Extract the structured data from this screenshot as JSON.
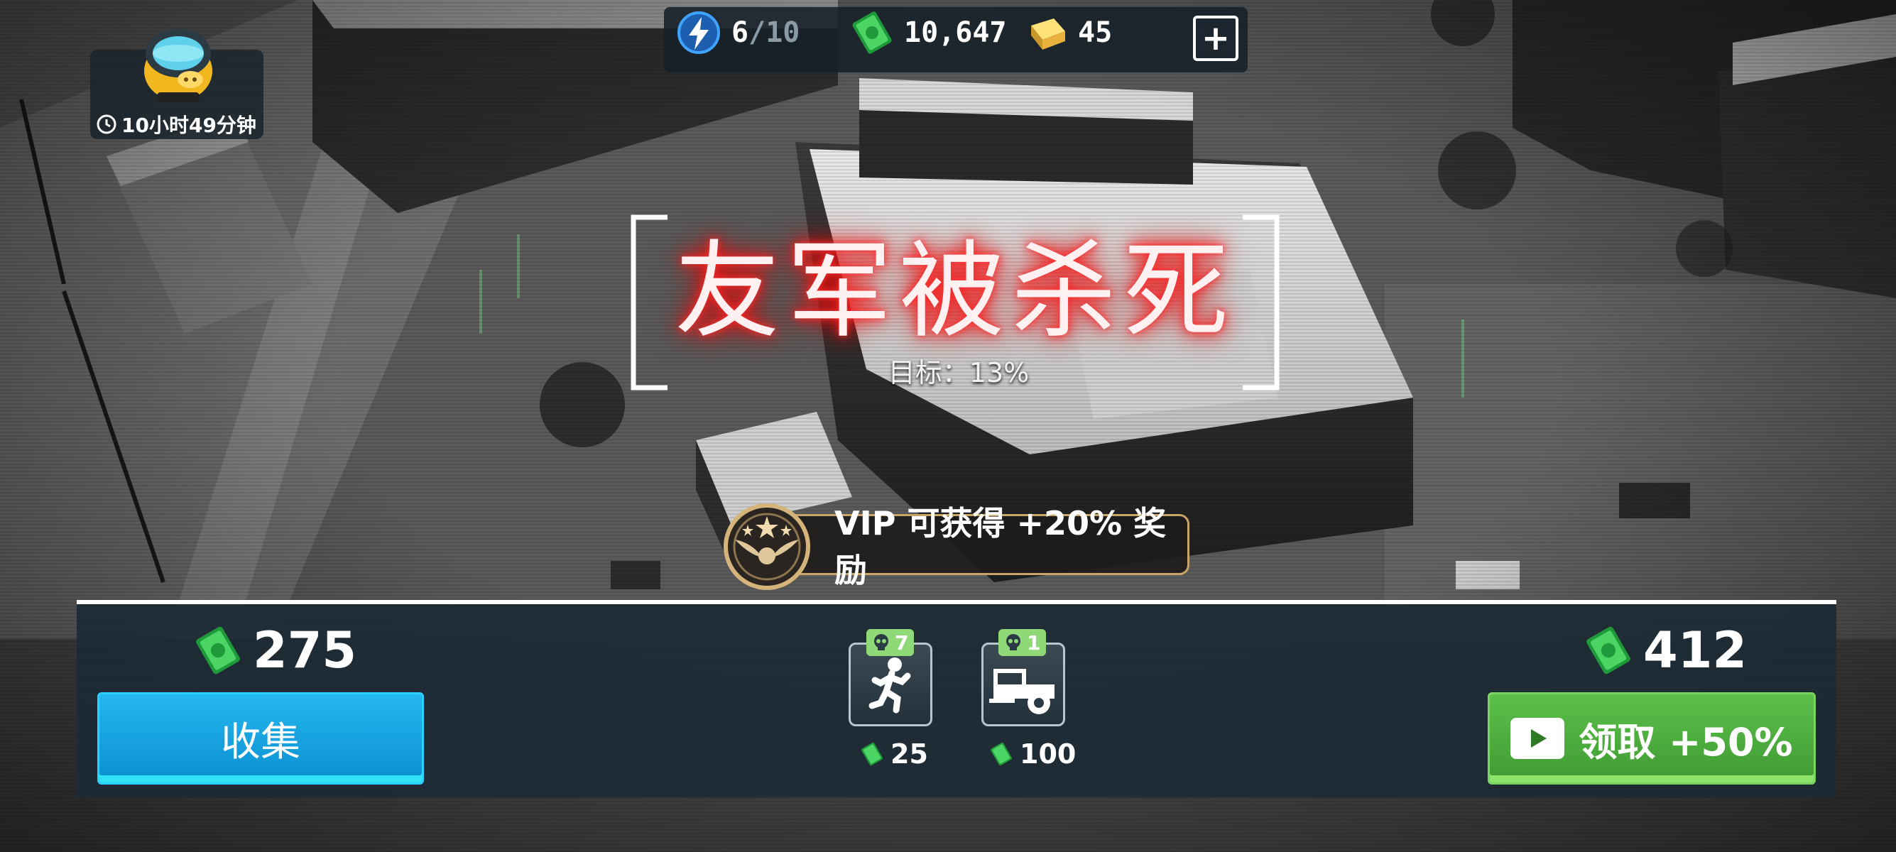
{
  "resources": {
    "energy_current": "6",
    "energy_separator": "/",
    "energy_max": "10",
    "cash": "10,647",
    "gold": "45",
    "add_label": "+",
    "icons": [
      "energy-bolt-icon",
      "cash-icon",
      "gold-bar-icon",
      "plus-icon"
    ]
  },
  "profile": {
    "avatar": "pig-pilot-avatar",
    "timer": "10小时49分钟",
    "timer_icon": "clock-icon"
  },
  "mission_result": {
    "title": "友军被杀死",
    "goal": "目标：13%"
  },
  "vip": {
    "text": "VIP 可获得 +20% 奖励",
    "emblem": "winged-star-emblem-icon"
  },
  "rewards": {
    "base_amount": "275",
    "collect_label": "收集",
    "bonus_amount": "412",
    "claim_label": "领取 +50%",
    "claim_icon": "video-play-icon"
  },
  "kills": [
    {
      "type": "soldier",
      "icon": "running-soldier-icon",
      "count": "7",
      "reward": "25"
    },
    {
      "type": "truck",
      "icon": "truck-icon",
      "count": "1",
      "reward": "100"
    }
  ],
  "colors": {
    "title_glow": "#ff1a1a",
    "collect_button": "#0a9ad8",
    "claim_button": "#4caf3c",
    "kill_badge": "#8fd979",
    "vip_border": "#c9a56a",
    "panel_bg": "#1c2a34"
  }
}
